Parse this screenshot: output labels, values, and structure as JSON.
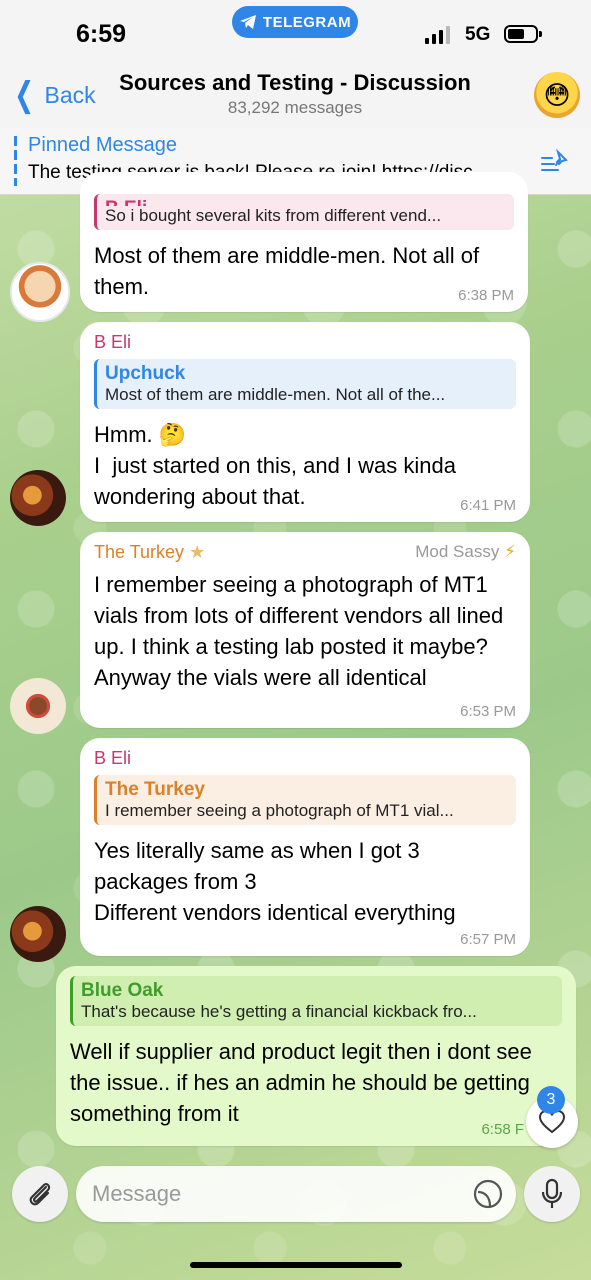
{
  "status": {
    "time": "6:59",
    "pill": "TELEGRAM",
    "network": "5G",
    "battery_pct": 62
  },
  "header": {
    "back_label": "Back",
    "title": "Sources and Testing - Discussion",
    "subtitle": "83,292 messages"
  },
  "pinned": {
    "label": "Pinned Message",
    "text": "The testing server is back! Please re-join! https://disc..."
  },
  "messages": [
    {
      "sender": "",
      "reply_name": "B Eli",
      "reply_text": "So i bought several kits from different vend...",
      "text": "Most of them are middle-men. Not all of them.",
      "time": "6:38 PM"
    },
    {
      "sender": "B Eli",
      "reply_name": "Upchuck",
      "reply_text": "Most of them are middle-men. Not all of the...",
      "text": "Hmm. 🤔\nI  just started on this, and I was kinda wondering about that.",
      "time": "6:41 PM"
    },
    {
      "sender": "The Turkey",
      "badge": "Mod Sassy",
      "text": "I remember seeing a photograph of MT1 vials from lots of different vendors all lined up. I think a testing lab posted it maybe? Anyway the vials were all identical",
      "time": "6:53 PM"
    },
    {
      "sender": "B Eli",
      "reply_name": "The Turkey",
      "reply_text": "I remember seeing a photograph of MT1 vial...",
      "text": "Yes literally same as when I got 3 packages from 3\nDifferent vendors identical everything",
      "time": "6:57 PM"
    },
    {
      "sender": "",
      "reply_name": "Blue Oak",
      "reply_text": "That's because he's getting a financial kickback fro...",
      "text": "Well if supplier and product legit then i dont see the issue.. if hes an admin he should be getting something from it",
      "time": "6:58 F"
    }
  ],
  "reactions": {
    "count": "3"
  },
  "composer": {
    "placeholder": "Message"
  },
  "colors": {
    "accent": "#2f86e6",
    "own_bubble": "#e4f9c9",
    "sender_pink": "#c23a6f",
    "sender_orange": "#d9822b",
    "reply_green": "#3f9d2a"
  },
  "icons": [
    "chevron-left-icon",
    "telegram-icon",
    "pin-icon",
    "heart-icon",
    "paperclip-icon",
    "sticker-icon",
    "microphone-icon",
    "star-icon",
    "bolt-icon"
  ]
}
